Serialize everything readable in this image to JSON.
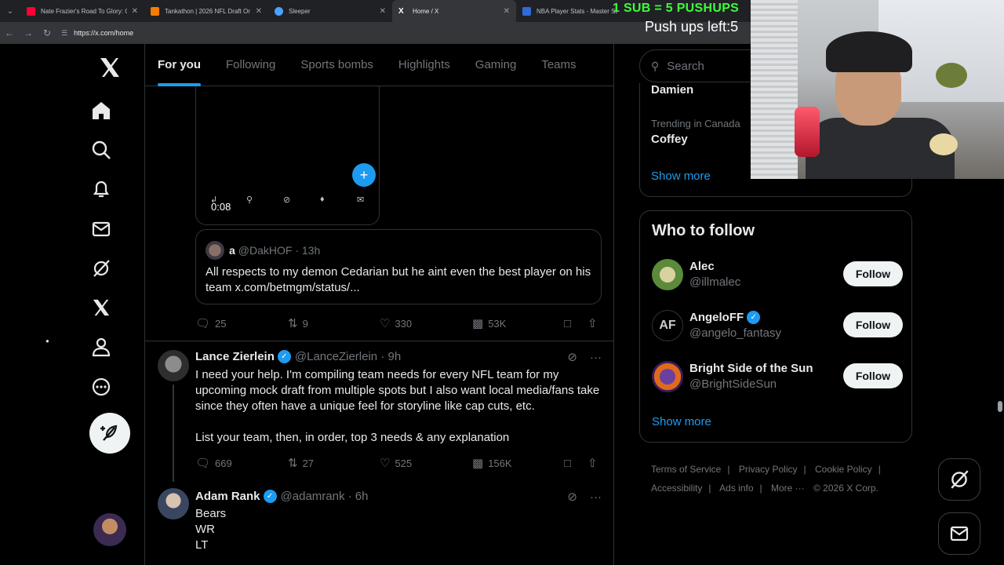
{
  "browser": {
    "tabs": [
      {
        "title": "Nate Frazier's Road To Glory: G",
        "favicon_color": "#ff0033",
        "active": false
      },
      {
        "title": "Tankathon | 2026 NFL Draft Or",
        "favicon_color": "#f57c00",
        "active": false
      },
      {
        "title": "Sleeper",
        "favicon_color": "#4aa3ff",
        "active": false
      },
      {
        "title": "Home / X",
        "favicon_color": "#ffffff",
        "active": true
      },
      {
        "title": "NBA Player Stats - Master St",
        "favicon_color": "#2f6bd8",
        "active": false
      }
    ],
    "url": "https://x.com/home"
  },
  "overlay": {
    "line1": "1 SUB = 5 PUSHUPS",
    "line2": "Push ups left:5"
  },
  "feed_tabs": [
    "For you",
    "Following",
    "Sports bombs",
    "Highlights",
    "Gaming",
    "Teams"
  ],
  "video": {
    "time": "0:08"
  },
  "quote": {
    "name": "a",
    "handle": "@DakHOF · 13h",
    "text": "All respects to my demon Cedarian but he aint even the best player on his team x.com/betmgm/status/..."
  },
  "post1_actions": {
    "replies": "25",
    "reposts": "9",
    "likes": "330",
    "views": "53K"
  },
  "post2": {
    "name": "Lance Zierlein",
    "handle": "@LanceZierlein · 9h",
    "text": "I need your help.  I'm compiling team needs for every NFL team for my upcoming mock draft from multiple spots but I also want local media/fans take since they often have a unique feel for storyline like cap cuts, etc.\n\nList your team, then, in order, top 3 needs & any explanation",
    "actions": {
      "replies": "669",
      "reposts": "27",
      "likes": "525",
      "views": "156K"
    }
  },
  "post3": {
    "name": "Adam Rank",
    "handle": "@adamrank · 6h",
    "text": "Bears\nWR\nLT"
  },
  "search": {
    "placeholder": "Search"
  },
  "trends": {
    "top_name": "Damien",
    "meta": "Trending in Canada",
    "name": "Coffey",
    "show_more": "Show more"
  },
  "who_to_follow": {
    "title": "Who to follow",
    "users": [
      {
        "name": "Alec",
        "handle": "@illmalec",
        "verified": false,
        "avatar_color": "#5a8a3a"
      },
      {
        "name": "AngeloFF",
        "handle": "@angelo_fantasy",
        "verified": true,
        "avatar_color": "#000000"
      },
      {
        "name": "Bright Side of the Sun",
        "handle": "@BrightSideSun",
        "verified": false,
        "avatar_color": "#e06a1b"
      }
    ],
    "follow_label": "Follow",
    "show_more": "Show more"
  },
  "footer": {
    "links": [
      "Terms of Service",
      "|",
      "Privacy Policy",
      "|",
      "Cookie Policy",
      "|",
      "Accessibility",
      "|",
      "Ads info",
      "|",
      "More ···",
      "© 2026 X Corp."
    ]
  },
  "colors": {
    "accent": "#1d9bf0",
    "background": "#000000",
    "border": "#2f3336",
    "muted": "#71767b",
    "overlay_green": "#3cff3c"
  }
}
